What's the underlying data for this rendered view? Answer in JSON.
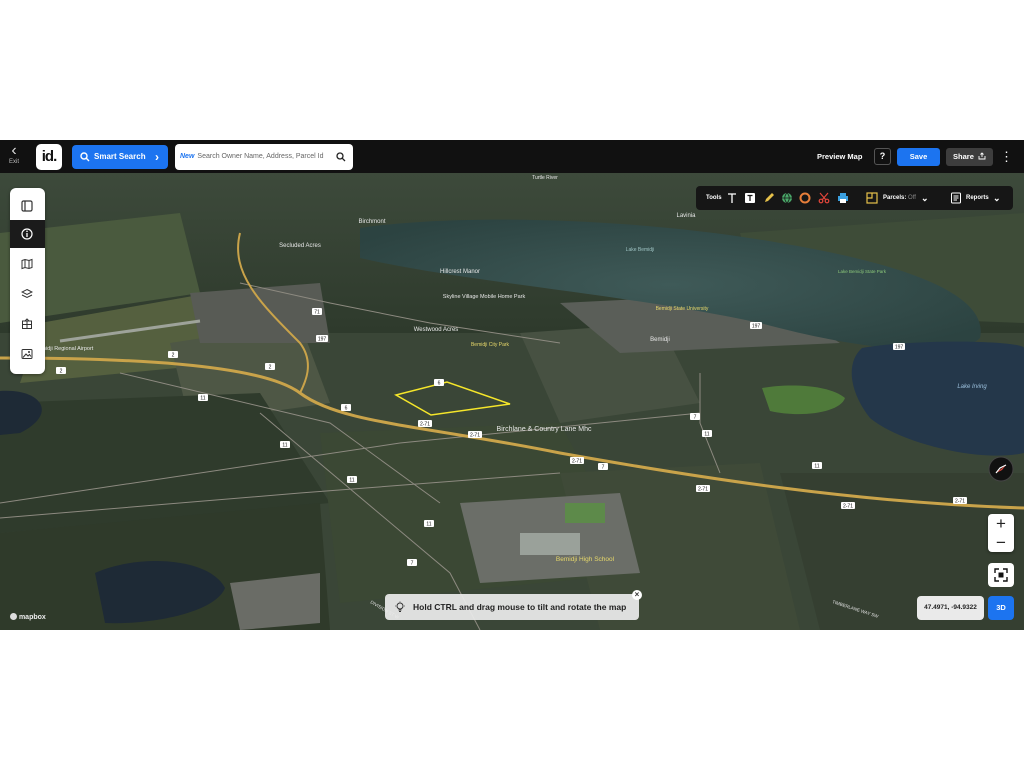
{
  "header": {
    "exit_label": "Exit",
    "logo_text": "id.",
    "smart_search_label": "Smart Search",
    "search_new_tag": "New",
    "search_placeholder": "Search Owner Name, Address, Parcel Id",
    "preview_label": "Preview Map",
    "help_label": "?",
    "save_label": "Save",
    "share_label": "Share"
  },
  "left_toolbar": {
    "items": [
      {
        "icon": "panel-icon",
        "active": false
      },
      {
        "icon": "info-icon",
        "active": true
      },
      {
        "icon": "map-icon",
        "active": false
      },
      {
        "icon": "layers-icon",
        "active": false
      },
      {
        "icon": "grid-icon",
        "active": false
      },
      {
        "icon": "image-icon",
        "active": false
      }
    ]
  },
  "tool_palette": {
    "tools_label": "Tools",
    "parcels_label": "Parcels:",
    "parcels_state": "Off",
    "reports_label": "Reports"
  },
  "map": {
    "place_labels": [
      "Birchmont",
      "Secluded Acres",
      "Hillcrest Manor",
      "Skyline Village Mobile Home Park",
      "Westwood Acres",
      "Bemidji City Park",
      "Bemidji State University",
      "Bemidji",
      "Lake Bemidji",
      "Lake Bemidji State Park",
      "Lavinia",
      "Lake Irving",
      "Bemidji Regional Airport",
      "Birchlane & Country Lane Mhc",
      "Bemidji High School",
      "Turtle River"
    ],
    "road_shields": [
      "2",
      "2-71",
      "11",
      "7",
      "197",
      "71",
      "6"
    ],
    "street_labels": [
      "DIVISION ST W",
      "TIMBERLANE WAY SW"
    ],
    "attribution": "mapbox"
  },
  "controls": {
    "zoom_in": "+",
    "zoom_out": "−",
    "hint_text": "Hold CTRL and drag mouse to tilt and rotate the map",
    "hint_close": "×",
    "coordinates": "47.4971, -94.9322",
    "view_mode": "3D"
  },
  "colors": {
    "accent": "#1c74f0",
    "topbar": "#111111",
    "parcel_outline": "#f5e62a",
    "highway": "#c9a34a"
  }
}
